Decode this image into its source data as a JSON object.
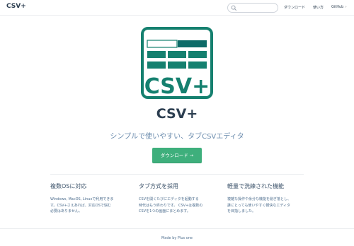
{
  "header": {
    "brand": "CSV+",
    "search": {
      "value": "",
      "placeholder": ""
    },
    "nav": [
      "ダウンロード",
      "使い方",
      "GitHub"
    ]
  },
  "hero": {
    "logo_text": "CSV+",
    "title": "CSV+",
    "tagline": "シンプルで使いやすい、タブCSVエディタ",
    "cta": "ダウンロード →"
  },
  "features": [
    {
      "title": "複数OSに対応",
      "lines": [
        "Windows, MacOS, Linuxで利用できま",
        "す。CSV+さえあれば、対応OSで悩む",
        "必要はありません。"
      ]
    },
    {
      "title": "タブ方式を採用",
      "lines": [
        "CSVを開くたびにエディタを起動する",
        "時代はもう終わりです。 CSV+は複数の",
        "CSVを1つの画面にまとめます。"
      ]
    },
    {
      "title": "軽量で洗練された機能",
      "lines": [
        "複雑な操作や余分な機能を削ぎ落とし、",
        "誰にとっても使いやすく軽快なエディタ",
        "を目指しました。"
      ]
    }
  ],
  "footer": "Made by Plus one",
  "colors": {
    "accent": "#3eaf7c",
    "logo_teal": "#15806f",
    "logo_dark": "#0d6b68",
    "text": "#2c3e50",
    "muted": "#6a8bad"
  },
  "icons": {
    "search": "search-icon",
    "external": "external-link-icon"
  }
}
